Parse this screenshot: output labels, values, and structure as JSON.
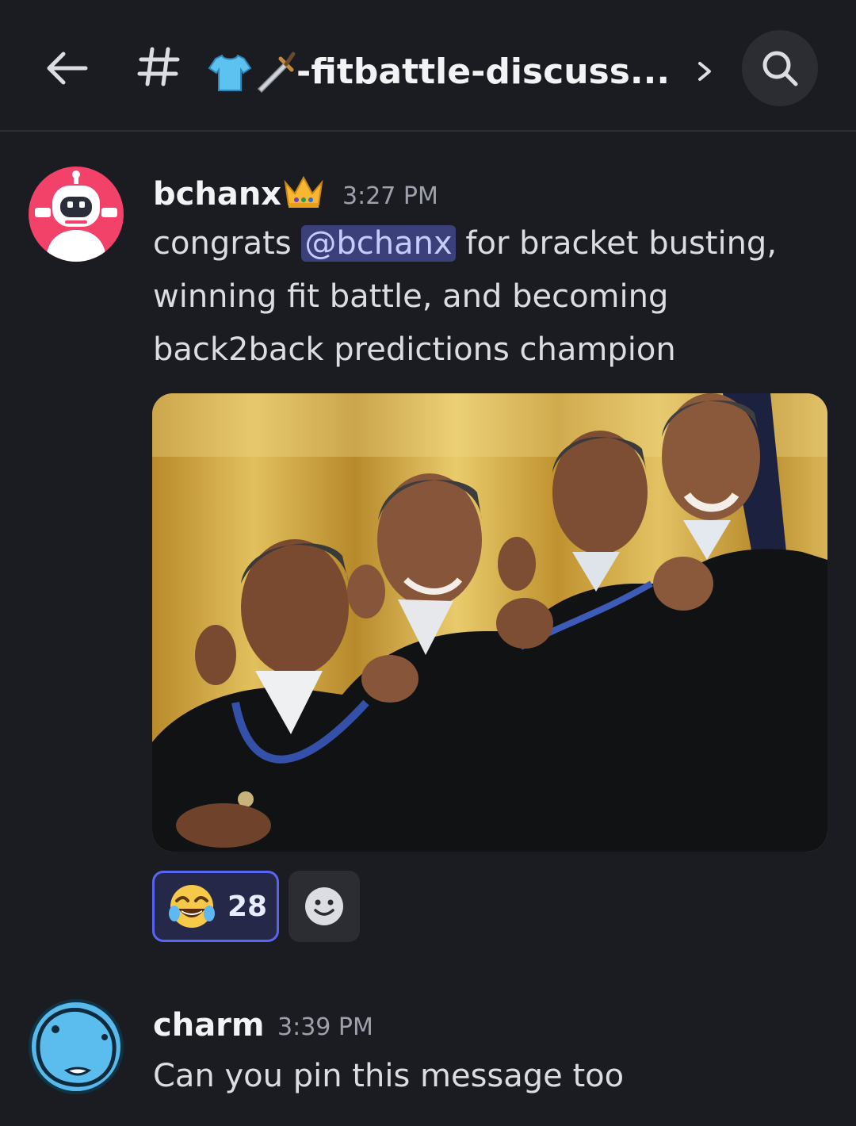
{
  "header": {
    "channel_name": "-fitbattle-discuss...",
    "icons": [
      "back-arrow-icon",
      "hash-icon",
      "shirt-icon",
      "sword-icon",
      "chevron-right-icon",
      "search-icon"
    ]
  },
  "messages": [
    {
      "username": "bchanx",
      "badge": "crown-icon",
      "timestamp": "3:27 PM",
      "text_before": "congrats ",
      "mention": "@bchanx",
      "text_after": " for bracket busting,",
      "line2": "winning fit battle, and becoming",
      "line3": "back2back predictions champion",
      "reactions": [
        {
          "emoji": "joy-emoji-icon",
          "count": "28",
          "selected": true
        }
      ]
    },
    {
      "username": "charm",
      "timestamp": "3:39 PM",
      "text": "Can you pin this message too"
    }
  ],
  "colors": {
    "background": "#1b1c21",
    "mention_bg": "#3b3f7a",
    "accent": "#5865f2"
  }
}
